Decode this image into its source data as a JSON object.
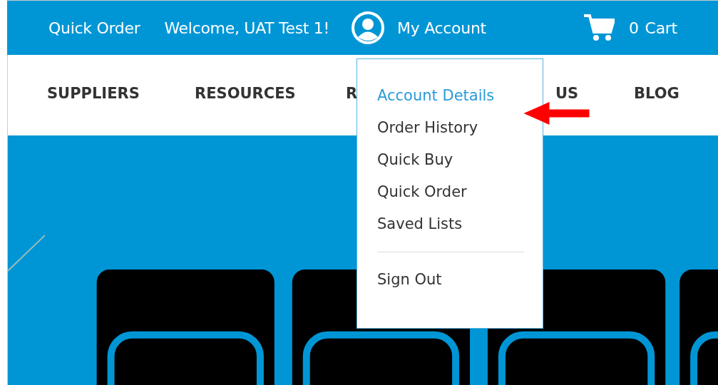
{
  "top_bar": {
    "quick_order": "Quick Order",
    "welcome": "Welcome, UAT Test 1!",
    "account": "My Account",
    "cart_count": "0",
    "cart_label": "Cart"
  },
  "nav": [
    {
      "label": "SUPPLIERS"
    },
    {
      "label": "RESOURCES"
    },
    {
      "label": "R"
    },
    {
      "label": "US"
    },
    {
      "label": "BLOG"
    }
  ],
  "account_menu": {
    "items": [
      {
        "label": "Account Details",
        "selected": true
      },
      {
        "label": "Order History",
        "selected": false
      },
      {
        "label": "Quick Buy",
        "selected": false
      },
      {
        "label": "Quick Order",
        "selected": false
      },
      {
        "label": "Saved Lists",
        "selected": false
      }
    ],
    "sign_out": "Sign Out"
  }
}
